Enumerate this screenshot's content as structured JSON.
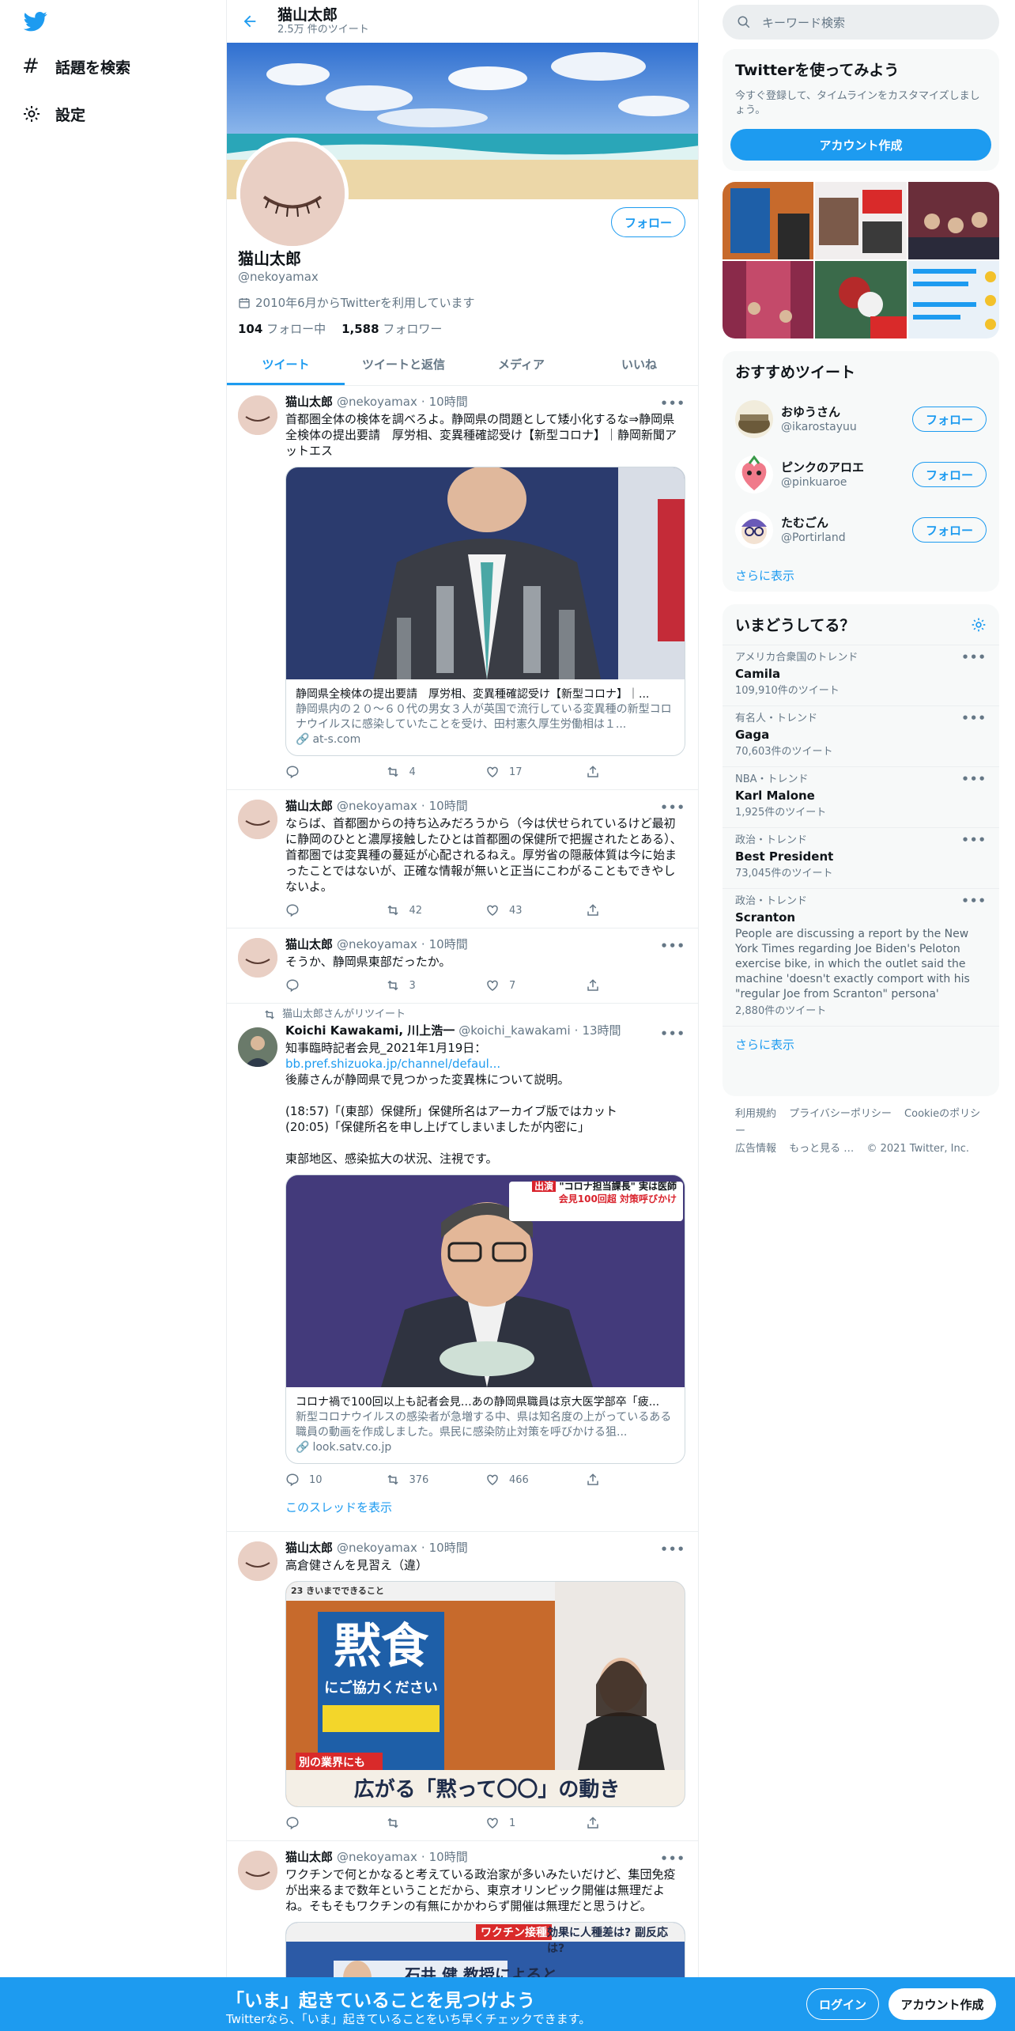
{
  "nav": {
    "explore": "話題を検索",
    "settings": "設定"
  },
  "profile": {
    "header_name": "猫山太郎",
    "tweet_count": "2.5万 件のツイート",
    "name": "猫山太郎",
    "handle": "@nekoyamax",
    "joined": "2010年6月からTwitterを利用しています",
    "following_count": "104",
    "following_label": "フォロー中",
    "followers_count": "1,588",
    "followers_label": "フォロワー",
    "follow_button": "フォロー"
  },
  "tabs": [
    "ツイート",
    "ツイートと返信",
    "メディア",
    "いいね"
  ],
  "tweets": [
    {
      "name": "猫山太郎",
      "handle": "@nekoyamax",
      "time": "10時間",
      "text": "首都圏全体の検体を調べろよ。静岡県の問題として矮小化するな⇒静岡県全検体の提出要請　厚労相、変異種確認受け【新型コロナ】｜静岡新聞アットエス",
      "card_title": "静岡県全検体の提出要請　厚労相、変異種確認受け【新型コロナ】｜...",
      "card_desc": "静岡県内の２０～６０代の男女３人が英国で流行している変異種の新型コロナウイルスに感染していたことを受け、田村憲久厚生労働相は１...",
      "card_url": "at-s.com",
      "replies": "",
      "retweets": "4",
      "likes": "17"
    },
    {
      "name": "猫山太郎",
      "handle": "@nekoyamax",
      "time": "10時間",
      "text": "ならば、首都圏からの持ち込みだろうから（今は伏せられているけど最初に静岡のひとと濃厚接触したひとは首都圏の保健所で把握されたとある）、首都圏では変異種の蔓延が心配されるねえ。厚労省の隠蔽体質は今に始まったことではないが、正確な情報が無いと正当にこわがることもできやしないよ。",
      "replies": "",
      "retweets": "42",
      "likes": "43"
    },
    {
      "name": "猫山太郎",
      "handle": "@nekoyamax",
      "time": "10時間",
      "text": "そうか、静岡県東部だったか。",
      "replies": "",
      "retweets": "3",
      "likes": "7"
    },
    {
      "rt_note": "猫山太郎さんがリツイート",
      "name": "Koichi Kawakami, 川上浩一",
      "handle": "@koichi_kawakami",
      "time": "13時間",
      "text_pre": "知事臨時記者会見_2021年1月19日：",
      "text_link": "bb.pref.shizuoka.jp/channel/defaul...",
      "text_post": "後藤さんが静岡県で見つかった変異株について説明。\n\n(18:57)「(東部）保健所」保健所名はアーカイブ版ではカット\n(20:05)「保健所名を申し上げてしまいましたが内密に」\n\n東部地区、感染拡大の状況、注視です。",
      "card_title": "コロナ禍で100回以上も記者会見…あの静岡県職員は京大医学部卒「疲...",
      "card_desc": "新型コロナウイルスの感染者が急増する中、県は知名度の上がっているある職員の動画を作成しました。県民に感染防止対策を呼びかける狙...",
      "card_url": "look.satv.co.jp",
      "card_overlay_1": "出演",
      "card_overlay_2": "\"コロナ担当課長\" 実は医師",
      "card_overlay_3": "会見100回超 対策呼びかけ",
      "replies": "10",
      "retweets": "376",
      "likes": "466",
      "thread": "このスレッドを表示"
    },
    {
      "name": "猫山太郎",
      "handle": "@nekoyamax",
      "time": "10時間",
      "text": "高倉健さんを見習え（違）",
      "media_badge": "23 きいまでできること",
      "media_sign": "黙食",
      "media_sign_sub": "にご協力ください",
      "media_caption": "広がる「黙って〇〇」の動き",
      "media_tag": "別の業界にも",
      "replies": "",
      "retweets": "",
      "likes": "1"
    },
    {
      "name": "猫山太郎",
      "handle": "@nekoyamax",
      "time": "10時間",
      "text": "ワクチンで何とかなると考えている政治家が多いみたいだけど、集団免疫が出来るまで数年ということだから、東京オリンピック開催は無理だよね。そもそもワクチンの有無にかかわらず開催は無理だと思うけど。",
      "media_tag_1": "ワクチン接種",
      "media_tag_2": "効果に人種差は? 副反応は?",
      "media_tag_3": "石井 健 教授によると…"
    }
  ],
  "right": {
    "search_placeholder": "キーワード検索",
    "signup_title": "Twitterを使ってみよう",
    "signup_sub": "今すぐ登録して、タイムラインをカスタマイズしましょう。",
    "signup_button": "アカウント作成",
    "who_title": "おすすめツイート",
    "who": [
      {
        "name": "おゆうさん",
        "handle": "@ikarostayuu",
        "button": "フォロー"
      },
      {
        "name": "ピンクのアロエ",
        "handle": "@pinkuaroe",
        "button": "フォロー"
      },
      {
        "name": "たむごん",
        "handle": "@Portirland",
        "button": "フォロー"
      }
    ],
    "who_more": "さらに表示",
    "trends_title": "いまどうしてる？",
    "trends": [
      {
        "context": "アメリカ合衆国のトレンド",
        "name": "Camila",
        "desc": "",
        "count": "109,910件のツイート"
      },
      {
        "context": "有名人・トレンド",
        "name": "Gaga",
        "desc": "",
        "count": "70,603件のツイート"
      },
      {
        "context": "NBA・トレンド",
        "name": "Karl Malone",
        "desc": "",
        "count": "1,925件のツイート"
      },
      {
        "context": "政治・トレンド",
        "name": "Best President",
        "desc": "",
        "count": "73,045件のツイート"
      },
      {
        "context": "政治・トレンド",
        "name": "Scranton",
        "desc": "People are discussing a report by the New York Times regarding Joe Biden's Peloton exercise bike, in which the outlet said the machine 'doesn't exactly comport with his \"regular Joe from Scranton\" persona'",
        "count": "2,880件のツイート"
      }
    ],
    "trends_more": "さらに表示",
    "footer": [
      "利用規約",
      "プライバシーポリシー",
      "Cookieのポリシー",
      "広告情報",
      "もっと見る …",
      "© 2021 Twitter, Inc."
    ]
  },
  "bottom": {
    "headline": "「いま」起きていることを見つけよう",
    "sub": "Twitterなら、「いま」起きていることをいち早くチェックできます。",
    "login": "ログイン",
    "signup": "アカウント作成"
  },
  "colors": {
    "accent": "#1d9bf0",
    "text": "#0f1419",
    "secondary": "#657786"
  }
}
